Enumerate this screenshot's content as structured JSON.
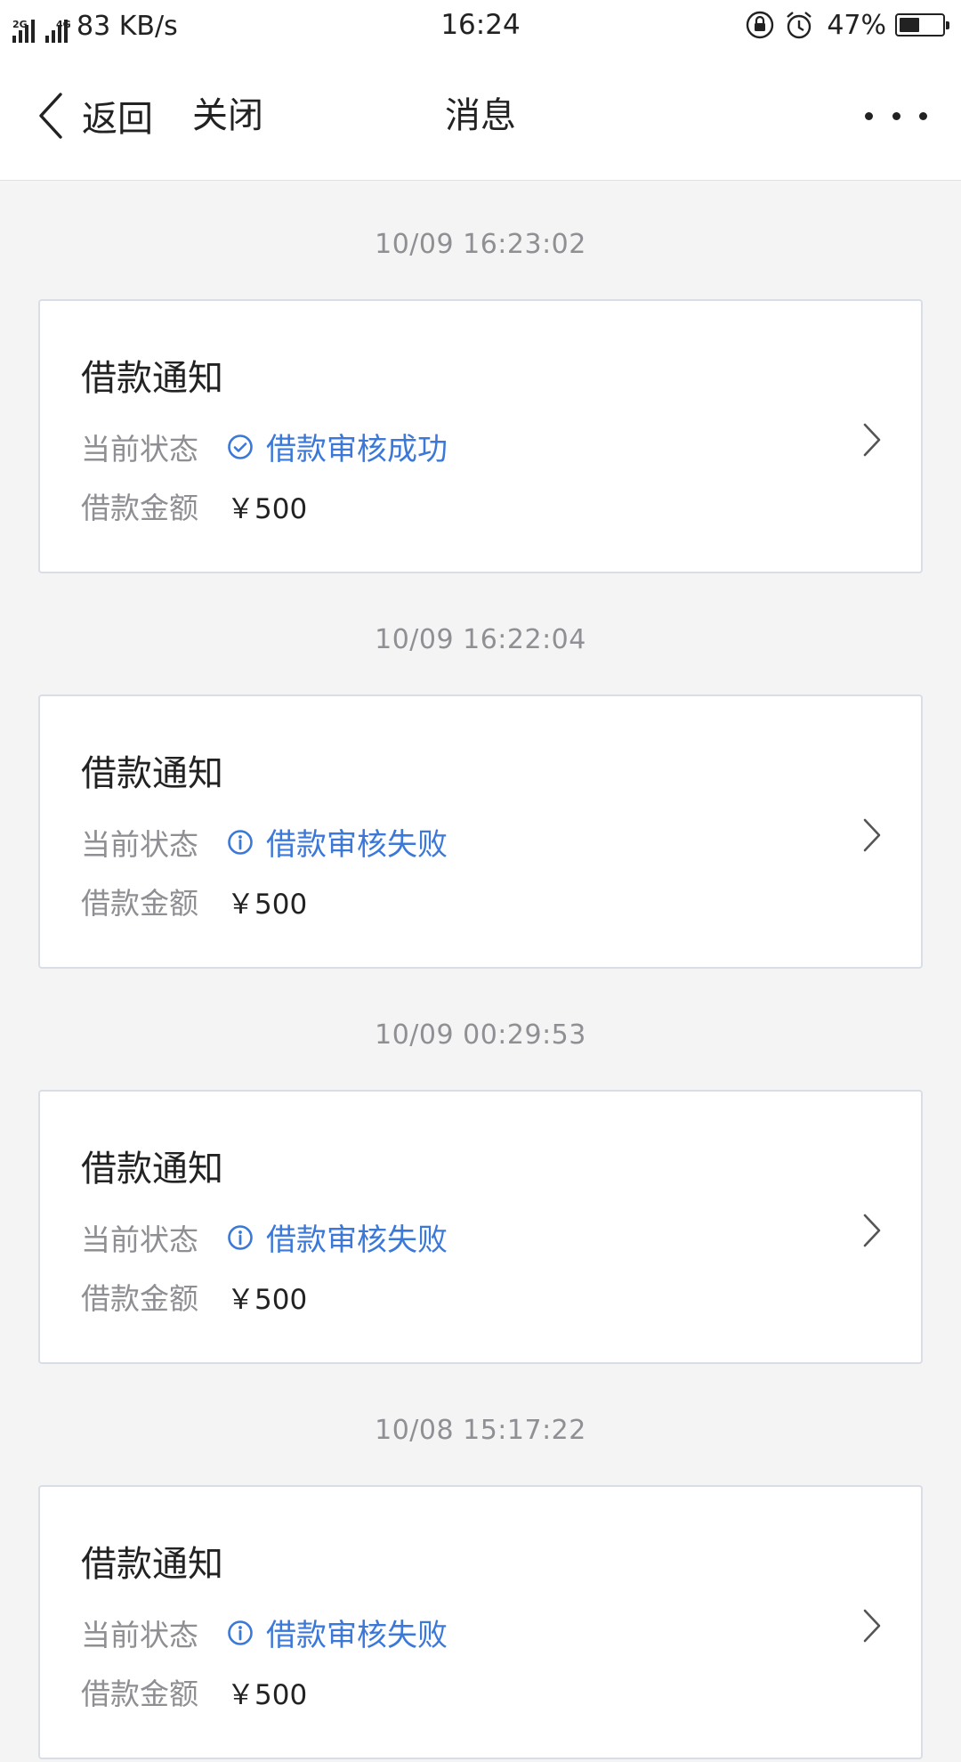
{
  "status_bar": {
    "net_label_1": "2G",
    "net_label_2": "4G",
    "speed": "83 KB/s",
    "time": "16:24",
    "battery_percent": "47%",
    "battery_level": 0.47,
    "icons": [
      "signal-icon",
      "signal-icon",
      "rotation-lock-icon",
      "alarm-icon",
      "battery-icon"
    ]
  },
  "nav": {
    "back_label": "返回",
    "close_label": "关闭",
    "title": "消息",
    "more_icon": "more-dots-icon"
  },
  "colors": {
    "accent": "#3b78d8",
    "label_gray": "#8e8e93",
    "time_gray": "#8f8f94",
    "background": "#f4f4f5",
    "card_border": "#d9dde6"
  },
  "messages": [
    {
      "time": "10/09 16:23:02",
      "title": "借款通知",
      "status_label": "当前状态",
      "status_icon": "check-circle-icon",
      "status_text": "借款审核成功",
      "amount_label": "借款金额",
      "amount": "￥500"
    },
    {
      "time": "10/09 16:22:04",
      "title": "借款通知",
      "status_label": "当前状态",
      "status_icon": "info-circle-icon",
      "status_text": "借款审核失败",
      "amount_label": "借款金额",
      "amount": "￥500"
    },
    {
      "time": "10/09 00:29:53",
      "title": "借款通知",
      "status_label": "当前状态",
      "status_icon": "info-circle-icon",
      "status_text": "借款审核失败",
      "amount_label": "借款金额",
      "amount": "￥500"
    },
    {
      "time": "10/08 15:17:22",
      "title": "借款通知",
      "status_label": "当前状态",
      "status_icon": "info-circle-icon",
      "status_text": "借款审核失败",
      "amount_label": "借款金额",
      "amount": "￥500"
    }
  ]
}
